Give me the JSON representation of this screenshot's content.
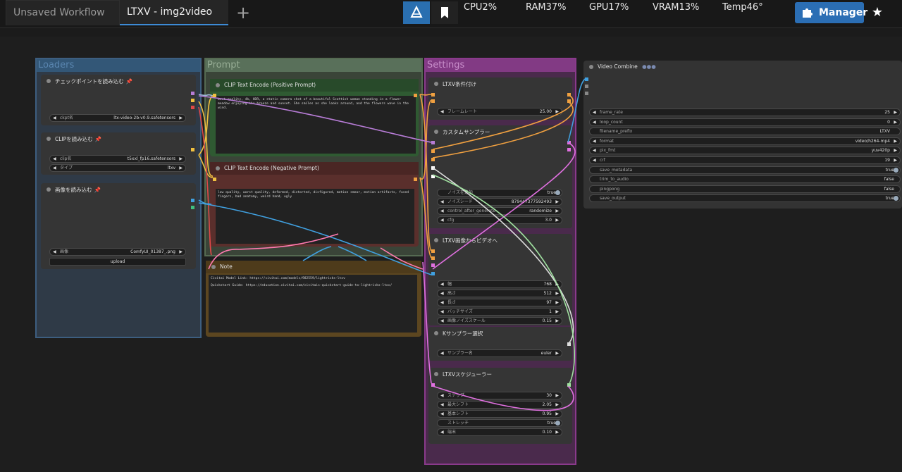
{
  "tabs": [
    {
      "label": "Unsaved Workflow",
      "active": false
    },
    {
      "label": "LTXV - img2video",
      "active": true
    }
  ],
  "new_tab_label": "+",
  "stats": [
    "CPU2%",
    "RAM37%",
    "GPU17%",
    "VRAM13%",
    "Temp46°"
  ],
  "manager_label": "Manager",
  "groups": {
    "loaders": "Loaders",
    "prompt": "Prompt",
    "settings": "Settings"
  },
  "nodes": {
    "checkpoint": {
      "title": "チェックポイントを読み込む",
      "widgets": [
        {
          "label": "ckpt名",
          "value": "ltx-video-2b-v0.9.safetensors"
        }
      ]
    },
    "clip_loader": {
      "title": "CLIPを読み込む",
      "widgets": [
        {
          "label": "clip名",
          "value": "t5xxl_fp16.safetensors"
        },
        {
          "label": "タイプ",
          "value": "ltxv"
        }
      ]
    },
    "load_image": {
      "title": "画像を読み込む",
      "widgets": [
        {
          "label": "画像",
          "value": "ComfyUI_01387_.png"
        }
      ],
      "upload_label": "upload"
    },
    "clip_pos": {
      "title": "CLIP Text Encode (Positive Prompt)",
      "text": "best quality, 4k, HDR, a static camera shot of a beautiful Scottish woman standing in a flower meadow enjoying the breeze and sunset. She smiles as she looks around, and the flowers wave in the wind."
    },
    "clip_neg": {
      "title": "CLIP Text Encode (Negative Prompt)",
      "text": "low quality, worst quality, deformed, distorted, disfigured, motion smear, motion artifacts, fused fingers, bad anatomy, weird hand, ugly"
    },
    "note": {
      "title": "Note",
      "line1": "Civitai Model Link: https://civitai.com/models/982559/lightricks-ltxv",
      "line2": "Quickstart Guide: https://education.civitai.com/civitais-quickstart-guide-to-lightricks-ltxv/"
    },
    "ltxv_cond": {
      "title": "LTXV条件付け",
      "widgets": [
        {
          "label": "フレームレート",
          "value": "25.00"
        }
      ]
    },
    "custom_sampler": {
      "title": "カスタムサンプラー",
      "widgets": [
        {
          "label": "ノイズを追加",
          "value": "true"
        },
        {
          "label": "ノイズシード",
          "value": "879447377592493"
        },
        {
          "label": "control_after_generate",
          "value": "randomize"
        },
        {
          "label": "cfg",
          "value": "3.0"
        }
      ]
    },
    "img2video": {
      "title": "LTXV画像からビデオへ",
      "widgets": [
        {
          "label": "幅",
          "value": "768"
        },
        {
          "label": "高さ",
          "value": "512"
        },
        {
          "label": "長さ",
          "value": "97"
        },
        {
          "label": "バッチサイズ",
          "value": "1"
        },
        {
          "label": "画像ノイズスケール",
          "value": "0.15"
        }
      ]
    },
    "ksampler_select": {
      "title": "Kサンプラー選択",
      "widgets": [
        {
          "label": "サンプラー名",
          "value": "euler"
        }
      ]
    },
    "scheduler": {
      "title": "LTXVスケジューラー",
      "widgets": [
        {
          "label": "ステップ",
          "value": "30"
        },
        {
          "label": "最大シフト",
          "value": "2.05"
        },
        {
          "label": "基本シフト",
          "value": "0.95"
        },
        {
          "label": "ストレッチ",
          "value": "true"
        },
        {
          "label": "端末",
          "value": "0.10"
        }
      ]
    },
    "video_combine": {
      "title": "Video Combine",
      "title_suffix": "●●●",
      "widgets": [
        {
          "label": "frame_rate",
          "value": "25"
        },
        {
          "label": "loop_count",
          "value": "0"
        },
        {
          "label": "filename_prefix",
          "value": "LTXV"
        },
        {
          "label": "format",
          "value": "video/h264-mp4"
        },
        {
          "label": "pix_fmt",
          "value": "yuv420p"
        },
        {
          "label": "crf",
          "value": "19"
        },
        {
          "label": "save_metadata",
          "value": "true"
        },
        {
          "label": "trim_to_audio",
          "value": "false"
        },
        {
          "label": "pingpong",
          "value": "false"
        },
        {
          "label": "save_output",
          "value": "true"
        }
      ]
    }
  },
  "colors": {
    "accent": "#2b6eb4",
    "loaders_group": "#335777",
    "prompt_group": "#59705a",
    "settings_group": "#823a84",
    "positive_node": "#2f5a32",
    "negative_node": "#5a2f2c",
    "note_node": "#5c4620"
  }
}
